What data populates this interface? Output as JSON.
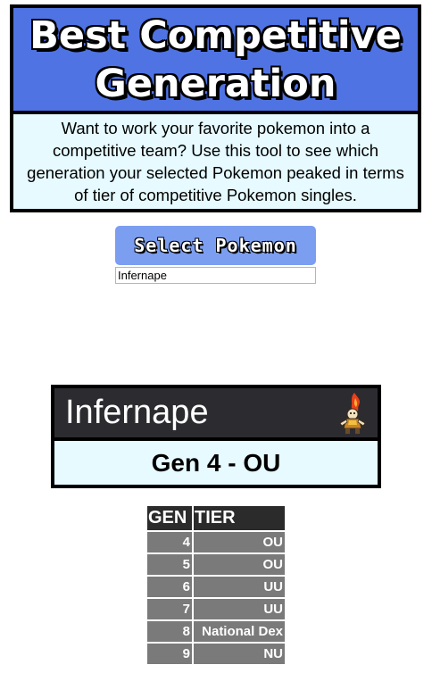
{
  "header": {
    "title": "Best Competitive Generation",
    "description": "Want to work your favorite pokemon into a competitive team? Use this tool to see which generation your selected Pokemon peaked in terms of tier of competitive Pokemon singles."
  },
  "selector": {
    "button_label": "Select Pokemon",
    "input_value": "Infernape"
  },
  "result": {
    "pokemon_name": "Infernape",
    "best": "Gen 4 - OU",
    "sprite_icon": "infernape-sprite-icon"
  },
  "table": {
    "headers": [
      "GEN",
      "TIER"
    ],
    "rows": [
      [
        "4",
        "OU"
      ],
      [
        "5",
        "OU"
      ],
      [
        "6",
        "UU"
      ],
      [
        "7",
        "UU"
      ],
      [
        "8",
        "National Dex"
      ],
      [
        "9",
        "NU"
      ]
    ]
  },
  "colors": {
    "title_bg": "#4f73e3",
    "desc_bg": "#e6faff",
    "button_bg": "#7c9ef0",
    "name_bar_bg": "#2c2c30",
    "table_header_bg": "#2b2b2b",
    "table_cell_bg": "#7a7a7a"
  }
}
